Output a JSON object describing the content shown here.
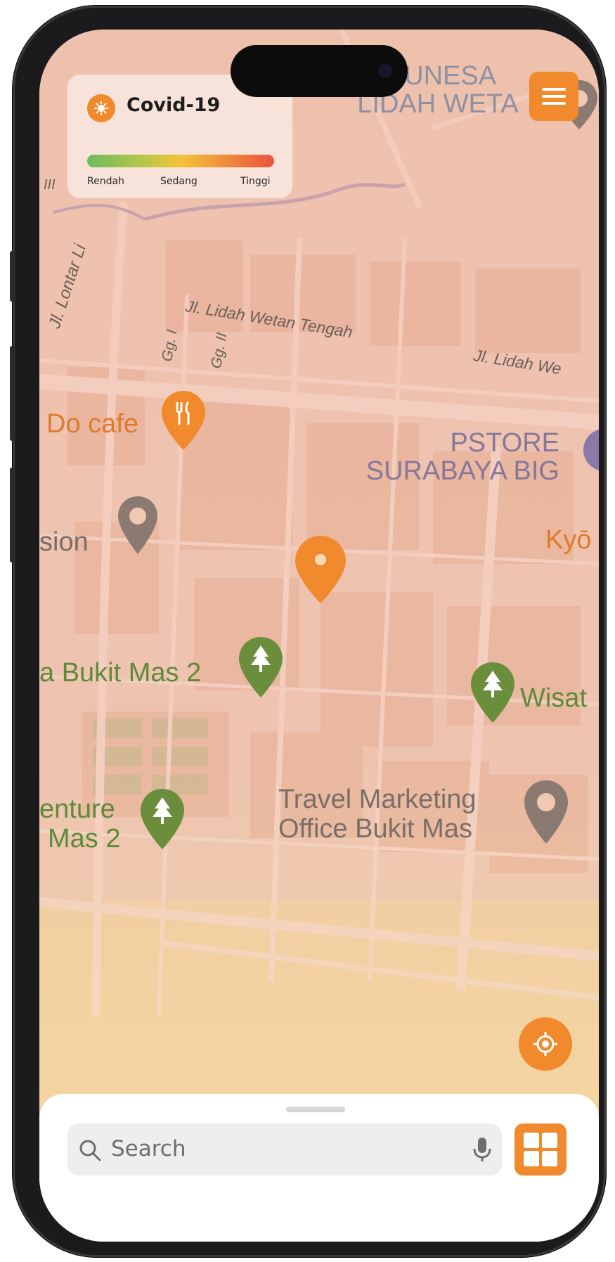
{
  "legend": {
    "title": "Covid-19",
    "levels": [
      "Rendah",
      "Sedang",
      "Tinggi"
    ],
    "icon": "virus-icon"
  },
  "map": {
    "streets": [
      "Jl. Lidah Wetan Tengah",
      "Jl. Lidah We",
      "Jl. Lontar Li",
      "Gg. I",
      "Gg. II",
      "III"
    ],
    "places": [
      {
        "name": "P UNESA",
        "line2": "LIDAH WETA",
        "kind": "education"
      },
      {
        "name": "Do cafe",
        "kind": "food"
      },
      {
        "name": "PSTORE",
        "line2": "SURABAYA BIG",
        "kind": "shop"
      },
      {
        "name": "sion",
        "kind": "place"
      },
      {
        "name": "Kyō",
        "kind": "food"
      },
      {
        "name": "a Bukit Mas 2",
        "kind": "park"
      },
      {
        "name": "Wisat",
        "kind": "park"
      },
      {
        "name": "enture",
        "line2": "Mas 2",
        "kind": "park"
      },
      {
        "name": "Travel Marketing",
        "line2": "Office Bukit Mas",
        "kind": "place"
      }
    ]
  },
  "search": {
    "placeholder": "Search"
  },
  "colors": {
    "accent": "#f08a2c",
    "low": "#6dbb5a",
    "mid": "#f4c33a",
    "high": "#e9533d"
  },
  "icons": {
    "menu": "hamburger-menu-icon",
    "locate": "locate-icon",
    "search": "search-icon",
    "mic": "microphone-icon",
    "grid": "grid-icon",
    "pin": "location-pin-icon"
  }
}
